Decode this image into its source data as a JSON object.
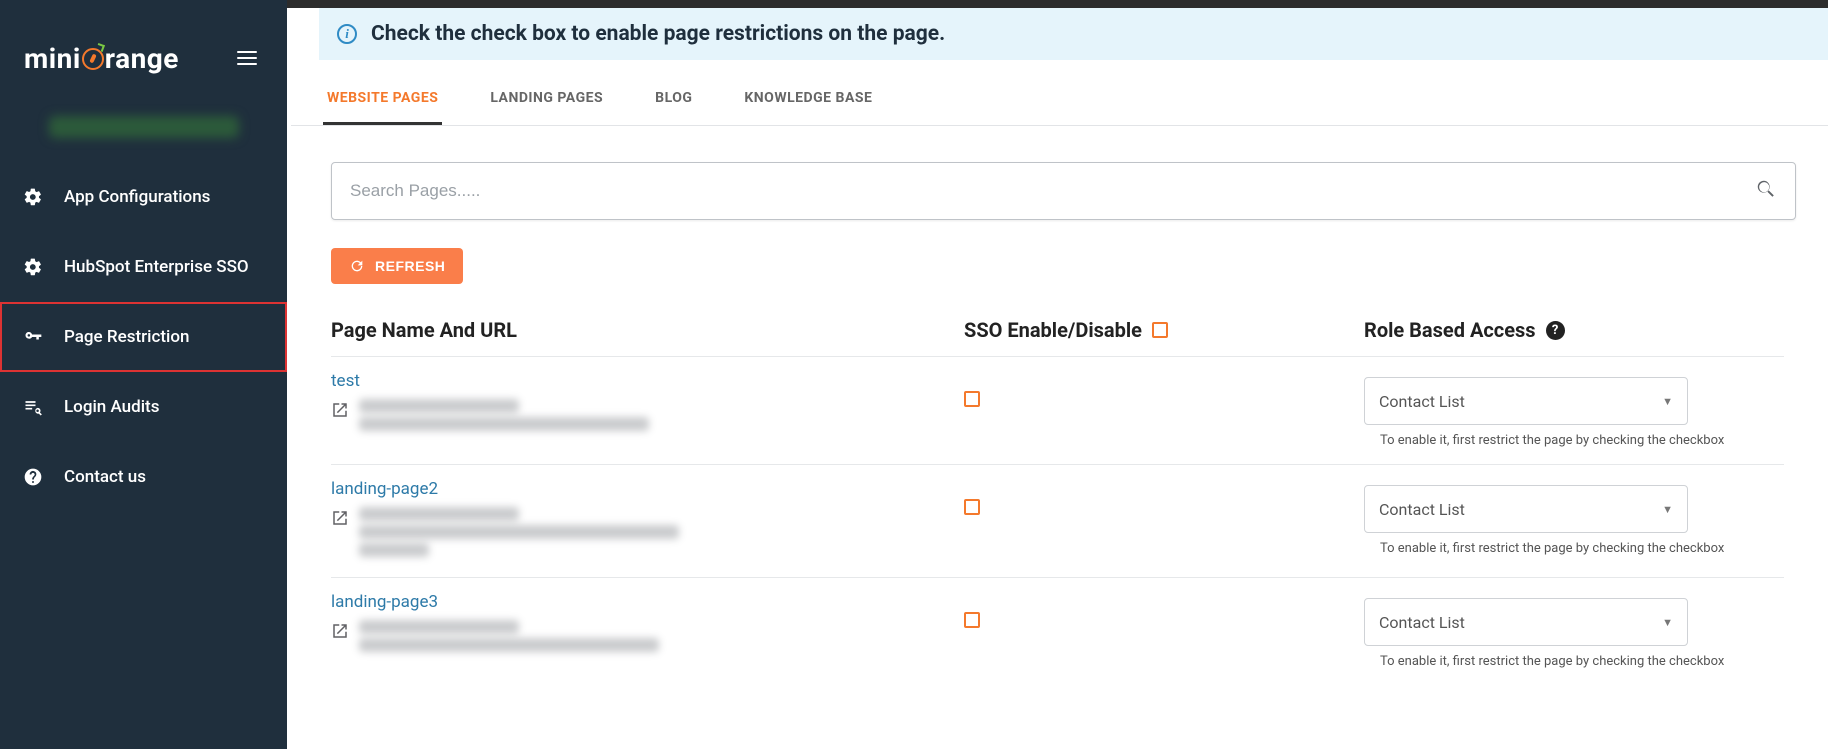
{
  "brand": {
    "mini": "mini",
    "range": "range"
  },
  "sidebar": {
    "items": [
      {
        "label": "App Configurations",
        "icon": "gear",
        "active": false
      },
      {
        "label": "HubSpot Enterprise SSO",
        "icon": "gear",
        "active": false
      },
      {
        "label": "Page Restriction",
        "icon": "key",
        "active": true
      },
      {
        "label": "Login Audits",
        "icon": "list-search",
        "active": false
      },
      {
        "label": "Contact us",
        "icon": "help",
        "active": false
      }
    ]
  },
  "banner": {
    "text": "Check the check box to enable page restrictions on the page."
  },
  "tabs": [
    {
      "label": "WEBSITE PAGES",
      "active": true
    },
    {
      "label": "LANDING PAGES",
      "active": false
    },
    {
      "label": "BLOG",
      "active": false
    },
    {
      "label": "KNOWLEDGE BASE",
      "active": false
    }
  ],
  "search": {
    "placeholder": "Search Pages....."
  },
  "refresh": {
    "label": "REFRESH"
  },
  "table": {
    "headers": {
      "name": "Page Name And URL",
      "sso": "SSO Enable/Disable",
      "role": "Role Based Access"
    },
    "role_select_label": "Contact List",
    "role_hint": "To enable it, first restrict the page by checking the checkbox",
    "rows": [
      {
        "name": "test"
      },
      {
        "name": "landing-page2"
      },
      {
        "name": "landing-page3"
      }
    ]
  }
}
